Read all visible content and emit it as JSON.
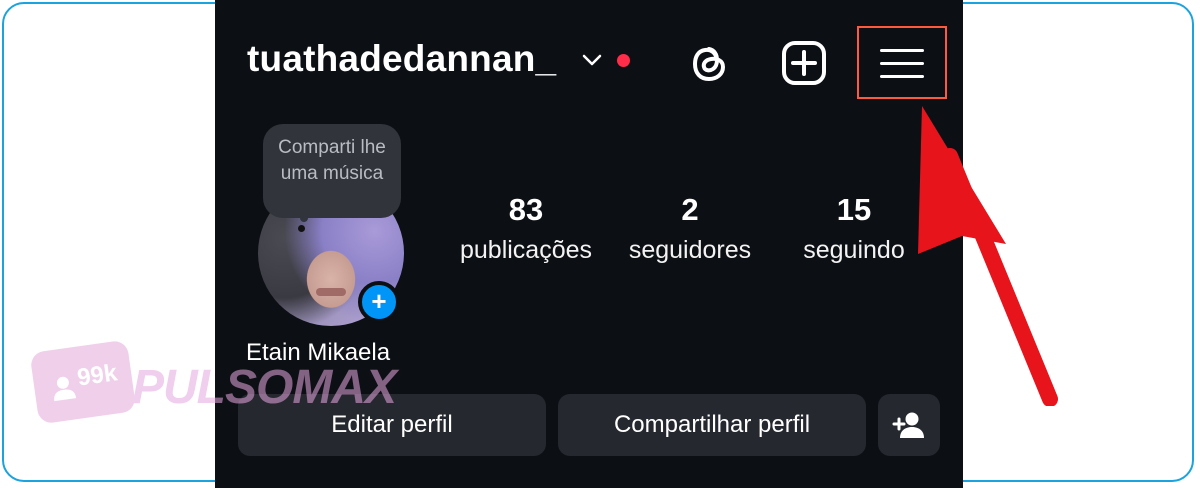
{
  "profile": {
    "username": "tuathadedannan_",
    "display_name": "Etain Mikaela",
    "note": "Comparti lhe uma música"
  },
  "stats": [
    {
      "value": "83",
      "label": "publicações"
    },
    {
      "value": "2",
      "label": "seguidores"
    },
    {
      "value": "15",
      "label": "seguindo"
    }
  ],
  "buttons": {
    "edit": "Editar perfil",
    "share": "Compartilhar perfil"
  },
  "icons": {
    "chevron": "chevron-down-icon",
    "threads": "threads-icon",
    "create": "add-post-icon",
    "menu": "hamburger-menu-icon",
    "add_story": "plus-icon",
    "discover_people": "add-person-icon"
  },
  "watermark": {
    "count": "99k",
    "brand": "PULSOMAX"
  },
  "colors": {
    "background": "#0c0f14",
    "notification_dot": "#ff2c4a",
    "highlight_box": "#ff5a3c",
    "arrow": "#e8141c",
    "accent_blue": "#0095f6",
    "frame_border": "#1aa3de"
  }
}
